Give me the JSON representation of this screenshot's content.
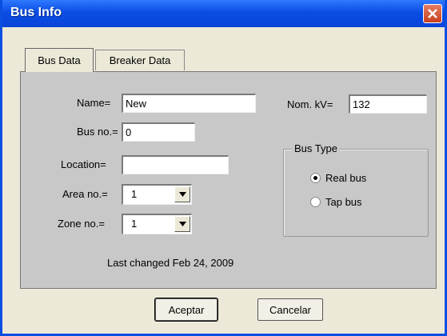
{
  "window": {
    "title": "Bus Info"
  },
  "tabs": [
    {
      "label": "Bus Data",
      "active": true
    },
    {
      "label": "Breaker Data",
      "active": false
    }
  ],
  "form": {
    "name_label": "Name=",
    "name_value": "New",
    "busno_label": "Bus no.=",
    "busno_value": "0",
    "location_label": "Location=",
    "location_value": "",
    "area_label": "Area no.=",
    "area_value": "1",
    "zone_label": "Zone no.=",
    "zone_value": "1",
    "nomkv_label": "Nom. kV=",
    "nomkv_value": "132",
    "last_changed": "Last changed Feb 24, 2009"
  },
  "bus_type": {
    "title": "Bus Type",
    "options": [
      {
        "label": "Real bus",
        "checked": true
      },
      {
        "label": "Tap bus",
        "checked": false
      }
    ]
  },
  "buttons": {
    "accept": "Aceptar",
    "cancel": "Cancelar"
  },
  "colors": {
    "titlebar": "#0a4de4",
    "panel": "#c8c8c8",
    "dialog": "#ece9d8",
    "close": "#d8572f"
  },
  "icons": {
    "close": "close-icon",
    "dropdown": "chevron-down-icon"
  }
}
